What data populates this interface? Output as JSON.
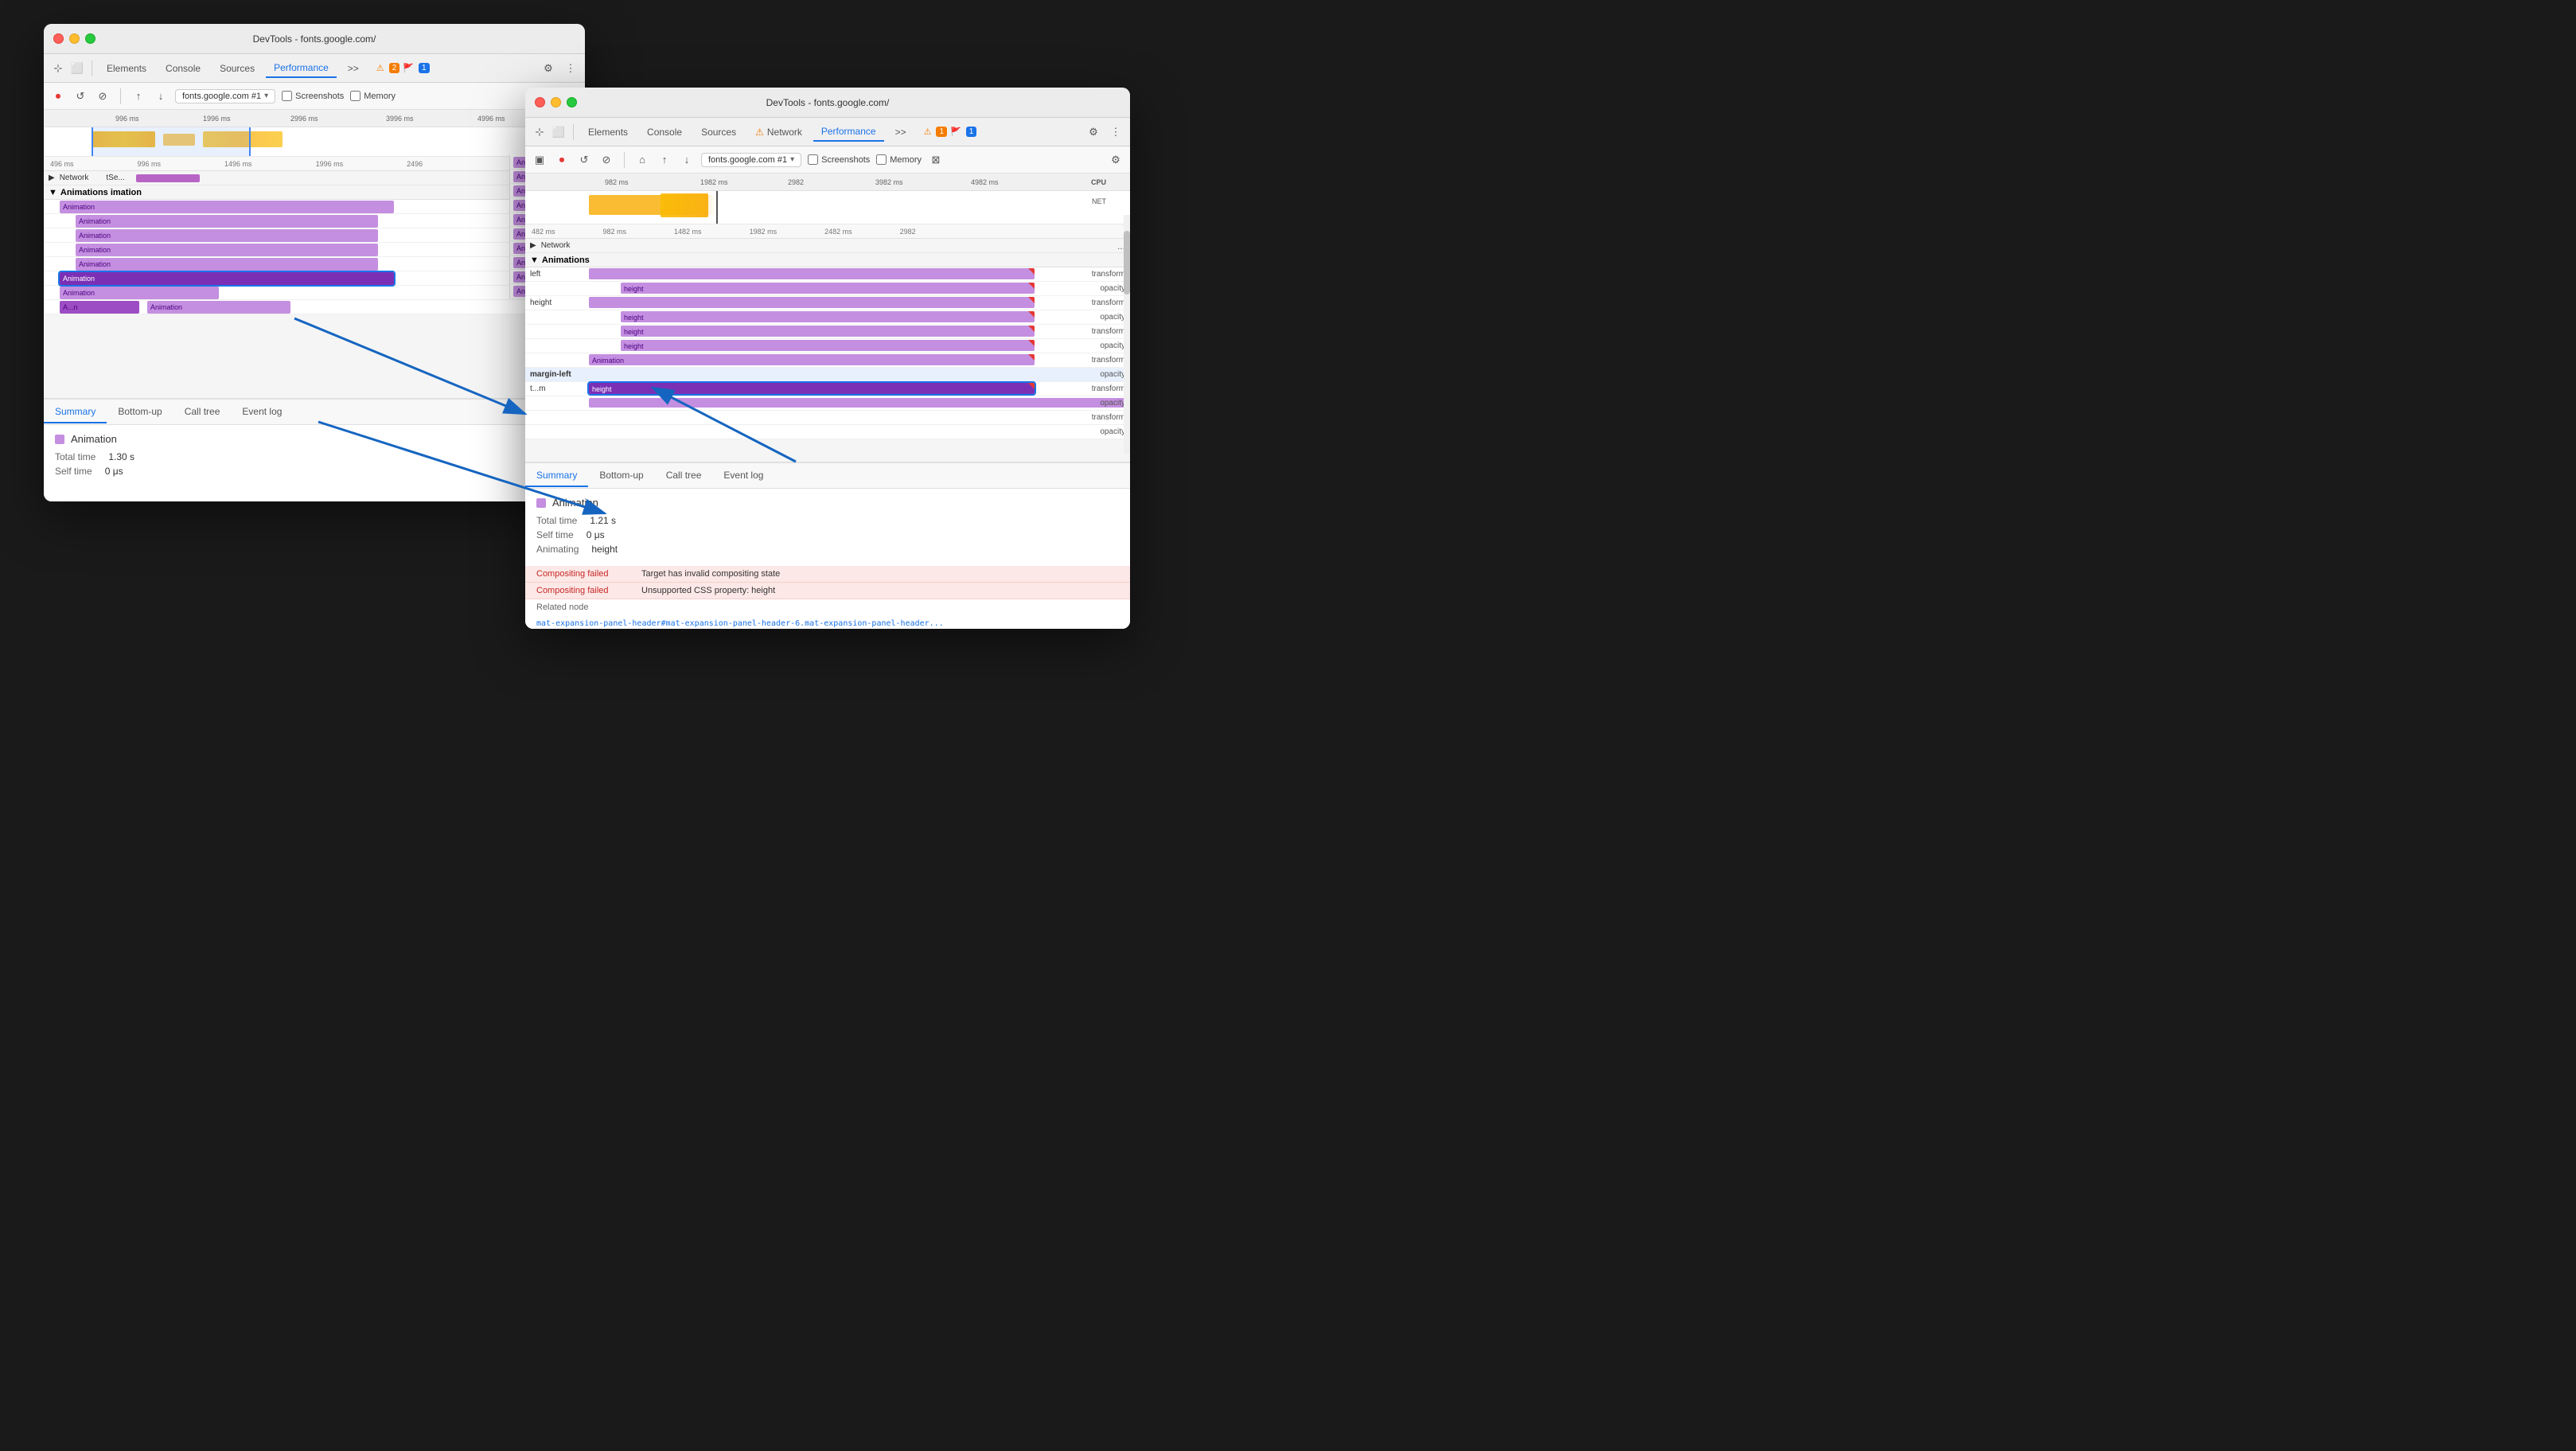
{
  "window_back": {
    "title": "DevTools - fonts.google.com/",
    "tabs": [
      "Elements",
      "Console",
      "Sources",
      "Performance",
      ">>"
    ],
    "active_tab": "Performance",
    "badges": [
      {
        "icon": "⚠",
        "count": "2",
        "color": "orange"
      },
      {
        "icon": "🚩",
        "count": "1",
        "color": "blue"
      }
    ],
    "rec_toolbar": {
      "url": "fonts.google.com #1",
      "checkboxes": [
        "Screenshots",
        "Memory"
      ]
    },
    "timeline": {
      "rulers": [
        "496 ms",
        "996 ms",
        "1496 ms",
        "1996 ms",
        "2496"
      ],
      "top_rulers": [
        "996 ms",
        "1996 ms",
        "2996 ms",
        "3996 ms",
        "4996 ms"
      ]
    },
    "sections": {
      "network": "Network",
      "tse": "tSe...",
      "animations": "Animations imation"
    },
    "animation_rows": [
      {
        "label": "Animation",
        "indent": 1
      },
      {
        "label": "Animation",
        "indent": 2
      },
      {
        "label": "Animation",
        "indent": 2
      },
      {
        "label": "Animation",
        "indent": 2
      },
      {
        "label": "Animation",
        "indent": 2
      },
      {
        "label": "Animation",
        "indent": 1,
        "selected": true
      },
      {
        "label": "Animation",
        "indent": 1
      },
      {
        "label": "A...n",
        "indent": 1
      },
      {
        "label": "Animation",
        "indent": 2
      }
    ],
    "right_animations": [
      "Animation",
      "Animation",
      "Animation",
      "Animation",
      "Animation",
      "Animation",
      "Animation",
      "Animation",
      "Animation",
      "Animation"
    ],
    "bottom_tabs": [
      "Summary",
      "Bottom-up",
      "Call tree",
      "Event log"
    ],
    "active_bottom_tab": "Summary",
    "summary": {
      "title": "Animation",
      "total_time_label": "Total time",
      "total_time_value": "1.30 s",
      "self_time_label": "Self time",
      "self_time_value": "0 μs"
    }
  },
  "window_front": {
    "title": "DevTools - fonts.google.com/",
    "tabs": [
      "Elements",
      "Console",
      "Sources",
      "Network",
      "Performance",
      ">>"
    ],
    "active_tab": "Performance",
    "badges": [
      {
        "icon": "⚠",
        "count": "1",
        "color": "orange"
      },
      {
        "icon": "🚩",
        "count": "1",
        "color": "blue"
      }
    ],
    "rec_toolbar": {
      "url": "fonts.google.com #1",
      "checkboxes": [
        "Screenshots",
        "Memory"
      ]
    },
    "timeline": {
      "rulers": [
        "482 ms",
        "982 ms",
        "1482 ms",
        "1982 ms",
        "2482 ms",
        "2982"
      ],
      "top_rulers": [
        "982 ms",
        "1982 ms",
        "2982",
        "3982 ms",
        "4982 ms"
      ],
      "labels": [
        "CPU",
        "NET"
      ]
    },
    "network_section": "Network",
    "animations_section": "Animations",
    "anim_rows": [
      {
        "prop": "left",
        "right_label": "transform"
      },
      {
        "prop": "height",
        "right_label": "opacity"
      },
      {
        "prop": "height",
        "right_label": "transform"
      },
      {
        "prop": "height",
        "right_label": "opacity"
      },
      {
        "prop": "height",
        "right_label": "transform"
      },
      {
        "prop": "height",
        "right_label": "opacity"
      },
      {
        "prop": "Animation",
        "right_label": "transform"
      },
      {
        "prop": "margin-left",
        "right_label": "opacity",
        "selected": true
      },
      {
        "prop": "t...m",
        "sub": "height",
        "right_label": "transform"
      },
      {
        "prop": "",
        "right_label": "opacity"
      },
      {
        "prop": "",
        "right_label": "transform"
      },
      {
        "prop": "",
        "right_label": "opacity"
      }
    ],
    "bottom_tabs": [
      "Summary",
      "Bottom-up",
      "Call tree",
      "Event log"
    ],
    "active_bottom_tab": "Summary",
    "summary": {
      "title": "Animation",
      "total_time_label": "Total time",
      "total_time_value": "1.21 s",
      "self_time_label": "Self time",
      "self_time_value": "0 μs",
      "animating_label": "Animating",
      "animating_value": "height",
      "errors": [
        {
          "label": "Compositing failed",
          "msg": "Target has invalid compositing state"
        },
        {
          "label": "Compositing failed",
          "msg": "Unsupported CSS property: height"
        }
      ],
      "related_node_label": "Related node",
      "related_node": "mat-expansion-panel-header#mat-expansion-panel-header-6.mat-expansion-panel-header..."
    }
  },
  "arrow": {
    "from": "back_selected_animation",
    "to": "front_margin_left_row"
  }
}
